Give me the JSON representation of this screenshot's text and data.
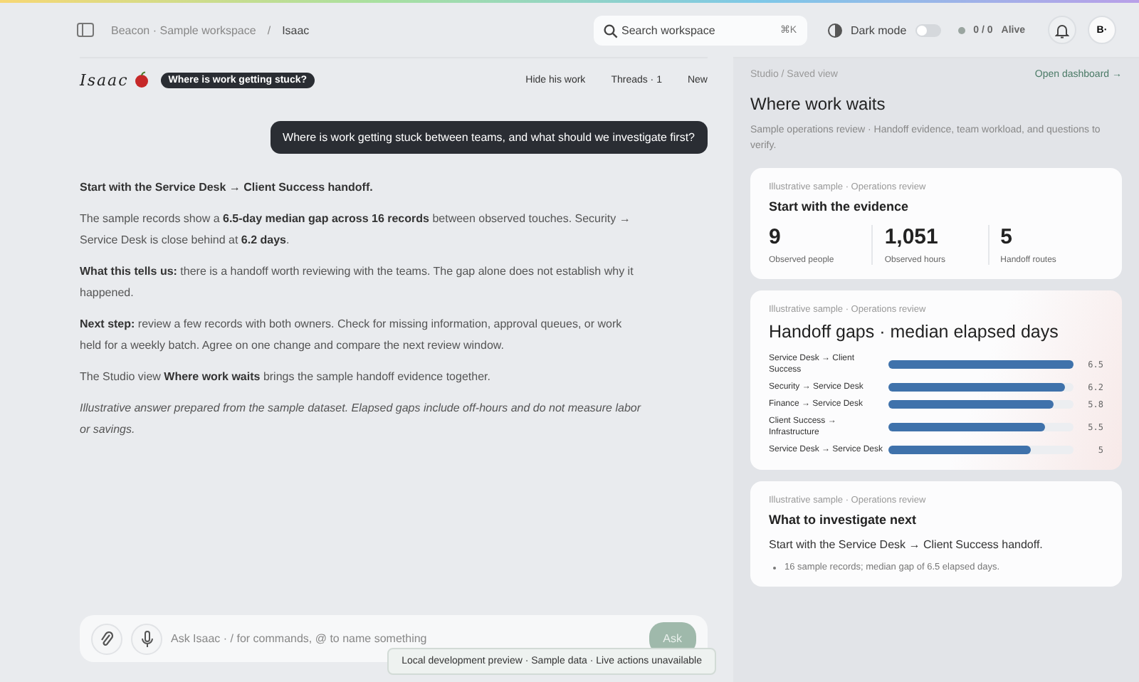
{
  "topbar": {
    "breadcrumb": [
      "Beacon · Sample workspace",
      "Isaac"
    ],
    "breadcrumb_separator": "/",
    "search": {
      "placeholder": "Search workspace",
      "shortcut": "⌘K"
    },
    "dark_mode": {
      "label": "Dark mode",
      "on": false
    },
    "status": {
      "count": "0 / 0",
      "label": "Alive"
    },
    "avatar": "B·"
  },
  "chat": {
    "logo": "Isaac",
    "topic": "Where is work getting stuck?",
    "actions": [
      "Hide his work",
      "Threads · 1",
      "New"
    ],
    "question": "Where is work getting stuck between teams, and what should we investigate first?",
    "answer": [
      {
        "kind": "lead",
        "text": "Start with the Service Desk → Client Success handoff."
      },
      {
        "kind": "para",
        "text": "The sample records show a **6.5-day median gap across 16 records** between observed touches. Security → Service Desk is close behind at **6.2 days**."
      },
      {
        "kind": "para",
        "text": "**What this tells us:** there is a handoff worth reviewing with the teams. The gap alone does not establish why it happened."
      },
      {
        "kind": "para",
        "text": "**Next step:** review a few records with both owners. Check for missing information, approval queues, or work held for a weekly batch. Agree on one change and compare the next review window."
      },
      {
        "kind": "para",
        "text": "The Studio view **Where work waits** brings the sample handoff evidence together."
      },
      {
        "kind": "note",
        "text": "Illustrative answer prepared from the sample dataset. Elapsed gaps include off-hours and do not measure labor or savings."
      }
    ],
    "composer": {
      "placeholder": "Ask Isaac · / for commands, @ to name something",
      "send": "Ask"
    },
    "toast": "Local development preview · Sample data · Live actions unavailable"
  },
  "studio": {
    "crumb": "Studio / Saved view",
    "link": "Open dashboard →",
    "title": "Where work waits",
    "subtitle": "Sample operations review · Handoff evidence, team workload, and questions to verify.",
    "evidence": {
      "eyebrow": "Illustrative sample · Operations review",
      "title": "Start with the evidence",
      "stats": [
        {
          "value": "9",
          "label": "Observed people"
        },
        {
          "value": "1,051",
          "label": "Observed hours"
        },
        {
          "value": "5",
          "label": "Handoff routes"
        }
      ]
    },
    "gaps": {
      "eyebrow": "Illustrative sample · Operations review",
      "chart_data": {
        "type": "bar",
        "orientation": "horizontal",
        "title": "Handoff gaps · median elapsed days",
        "categories": [
          "Service Desk → Client Success",
          "Security → Service Desk",
          "Finance → Service Desk",
          "Client Success → Infrastructure",
          "Service Desk → Service Desk"
        ],
        "values": [
          6.5,
          6.2,
          5.8,
          5.5,
          5
        ],
        "data_labels": true
      }
    },
    "next": {
      "eyebrow": "Illustrative sample · Operations review",
      "title": "What to investigate next",
      "lead": "Start with the Service Desk → Client Success handoff.",
      "bullets": [
        "16 sample records; median gap of 6.5 elapsed days."
      ]
    }
  }
}
